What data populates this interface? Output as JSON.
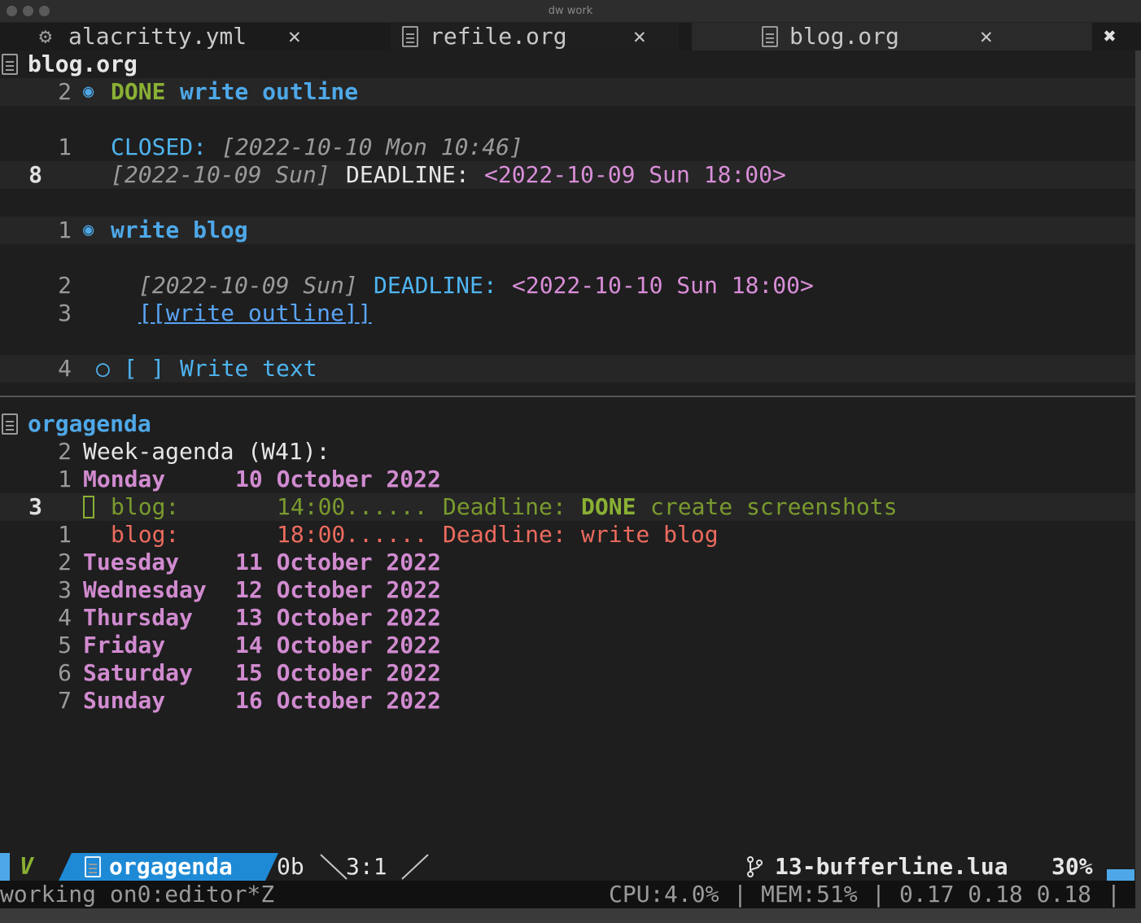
{
  "window": {
    "title": "dw work"
  },
  "tabs": [
    {
      "label": "alacritty.yml",
      "icon": "gear-icon",
      "close": "✕"
    },
    {
      "label": "refile.org",
      "icon": "document-icon",
      "close": "✕"
    },
    {
      "label": "blog.org",
      "icon": "document-icon",
      "close": "✕"
    },
    {
      "label": "",
      "icon": "close-all-icon",
      "close": "✖"
    }
  ],
  "top_pane": {
    "filename": "blog.org",
    "lines": {
      "l1_num": "2",
      "l1_done": "DONE",
      "l1_title": "write outline",
      "l2_num": "1",
      "l2_closed": "CLOSED:",
      "l2_date": "[2022-10-10 Mon 10:46]",
      "l3_num": "8",
      "l3_date": "[2022-10-09 Sun]",
      "l3_deadline": "DEADLINE:",
      "l3_ts": "<2022-10-09 Sun 18:00>",
      "l4_num": "1",
      "l4_title": "write blog",
      "l5_num": "2",
      "l5_date": "[2022-10-09 Sun]",
      "l5_deadline": "DEADLINE:",
      "l5_ts": "<2022-10-10 Sun 18:00>",
      "l6_num": "3",
      "l6_link": "[[write outline]]",
      "l7_num": "4",
      "l7_checkbox": "○ [ ]",
      "l7_text": "Write text"
    }
  },
  "bottom_pane": {
    "filename": "orgagenda",
    "header_num": "2",
    "header": "Week-agenda (W41):",
    "days": [
      {
        "num": "1",
        "day": "Monday",
        "date": "10 October 2022"
      },
      {
        "num": "2",
        "day": "Tuesday",
        "date": "11 October 2022"
      },
      {
        "num": "3",
        "day": "Wednesday",
        "date": "12 October 2022"
      },
      {
        "num": "4",
        "day": "Thursday",
        "date": "13 October 2022"
      },
      {
        "num": "5",
        "day": "Friday",
        "date": "14 October 2022"
      },
      {
        "num": "6",
        "day": "Saturday",
        "date": "15 October 2022"
      },
      {
        "num": "7",
        "day": "Sunday",
        "date": "16 October 2022"
      }
    ],
    "entries": [
      {
        "num": "3",
        "cat": "blog:",
        "time": "14:00......",
        "label": "Deadline:",
        "state": "DONE",
        "title": "create screenshots"
      },
      {
        "num": "1",
        "cat": "blog:",
        "time": "18:00......",
        "label": "Deadline:",
        "state": "",
        "title": "write blog"
      }
    ]
  },
  "statusline": {
    "mode": "V",
    "buffer": "orgagenda",
    "size": "0b",
    "position": "3:1",
    "branch": "13-bufferline.lua",
    "percent": "30%"
  },
  "tmux": {
    "session": "working on0:editor*Z",
    "cpu_label": "CPU:",
    "cpu": "4.0%",
    "mem_label": "MEM:",
    "mem": "51%",
    "load": "0.17 0.18 0.18",
    "sep": "|"
  },
  "colors": {
    "accent": "#4ea8e8",
    "done": "#8ab034",
    "heading": "#d18bd0",
    "error": "#ec6b5e"
  }
}
